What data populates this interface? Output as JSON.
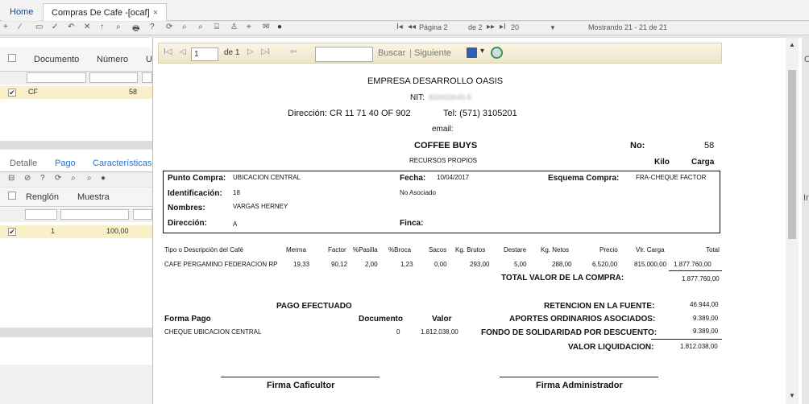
{
  "tabs": {
    "home": "Home",
    "compras": "Compras De Cafe -[ocaf]",
    "close": "×"
  },
  "toolbar": {
    "icons": [
      "+",
      "⁄",
      "▭",
      "✓",
      "↶",
      "✕",
      "↑",
      "⌕",
      "🖶",
      "?",
      "⟳",
      "⌕",
      "⌕",
      "⌸",
      "♙",
      "⌖",
      "✉",
      "●"
    ],
    "page_label": "Página 2",
    "of_label": "de 2",
    "nav_first": "I◂",
    "nav_prev": "◂◂",
    "nav_next": "▸▸",
    "nav_last": "▸I",
    "page_size": "20",
    "page_size_arrow": "▼",
    "showing": "Mostrando 21 - 21 de 21"
  },
  "master": {
    "col_documento": "Documento",
    "col_numero": "Número",
    "col_extra": "U",
    "row": {
      "documento": "CF",
      "numero": "58",
      "check": "✔"
    }
  },
  "detail": {
    "tabs": [
      "Detalle",
      "Pago",
      "Características"
    ],
    "tb_icons": [
      "⊟",
      "⊘",
      "?",
      "⟳",
      "⌕",
      "⌕",
      "●"
    ],
    "col_renglon": "Renglón",
    "col_muestra": "Muestra",
    "row": {
      "renglon": "1",
      "muestra": "100,00",
      "check": "✔"
    }
  },
  "report_toolbar": {
    "first": "I◁",
    "prev": "◁",
    "page": "1",
    "of": "de 1",
    "next": "▷",
    "last": "▷I",
    "back": "⇦",
    "search_placeholder": "",
    "buscar": "Buscar",
    "siguiente": "Siguiente",
    "sep": "|",
    "export_arrow": "▾"
  },
  "report": {
    "empresa": "EMPRESA DESARROLLO OASIS",
    "nit_label": "NIT:",
    "nit_value": "830003645-5",
    "direccion": "Dirección: CR 11 71 40 OF 902",
    "tel": "Tel: (571) 3105201",
    "email": "email:",
    "title": "COFFEE BUYS",
    "no_label": "No:",
    "no_value": "58",
    "subtitle": "RECURSOS PROPIOS",
    "kilo": "Kilo",
    "carga": "Carga",
    "punto_compra_label": "Punto Compra:",
    "punto_compra": "UBICACION CENTRAL",
    "fecha_label": "Fecha:",
    "fecha": "10/04/2017",
    "esquema_label": "Esquema Compra:",
    "esquema": "FRA-CHEQUE FACTOR",
    "identificacion_label": "Identificación:",
    "identificacion": "18",
    "no_asociado": "No Asociado",
    "nombres_label": "Nombres:",
    "nombres": "VARGAS HERNEY",
    "direccion_label": "Dirección:",
    "direccion_val": "A",
    "finca_label": "Finca:",
    "table_headers": [
      "Tipo o Descripción del Café",
      "Merma",
      "Factor",
      "%Pasilla",
      "%Broca",
      "Sacos",
      "Kg. Brutos",
      "Destare",
      "Kg. Netos",
      "Precio",
      "Vlr. Carga",
      "Total"
    ],
    "table_row": [
      "CAFE PERGAMINO FEDERACION RP",
      "19,33",
      "90,12",
      "2,00",
      "1,23",
      "0,00",
      "293,00",
      "5,00",
      "288,00",
      "6.520,00",
      "815.000,00",
      "1.877.760,00"
    ],
    "total_compra_label": "TOTAL VALOR DE LA COMPRA:",
    "total_compra": "1.877.760,00",
    "pago_efectuado": "PAGO EFECTUADO",
    "forma_pago": "Forma Pago",
    "documento": "Documento",
    "valor": "Valor",
    "pago_forma": "CHEQUE  UBICACION CENTRAL",
    "pago_doc": "0",
    "pago_valor": "1.812.038,00",
    "retencion_label": "RETENCION EN LA FUENTE:",
    "retencion": "46.944,00",
    "aportes_label": "APORTES ORDINARIOS ASOCIADOS:",
    "aportes": "9.389,00",
    "fondo_label": "FONDO DE SOLIDARIDAD POR DESCUENTO:",
    "fondo": "9.389,00",
    "liquidacion_label": "VALOR LIQUIDACION:",
    "liquidacion": "1.812.038,00",
    "firma_caficultor": "Firma Caficultor",
    "firma_admin": "Firma Administrador"
  },
  "right_edge": {
    "top": "C",
    "mid": "Ir"
  },
  "scroll": {
    "up": "▲",
    "down": "▼"
  }
}
